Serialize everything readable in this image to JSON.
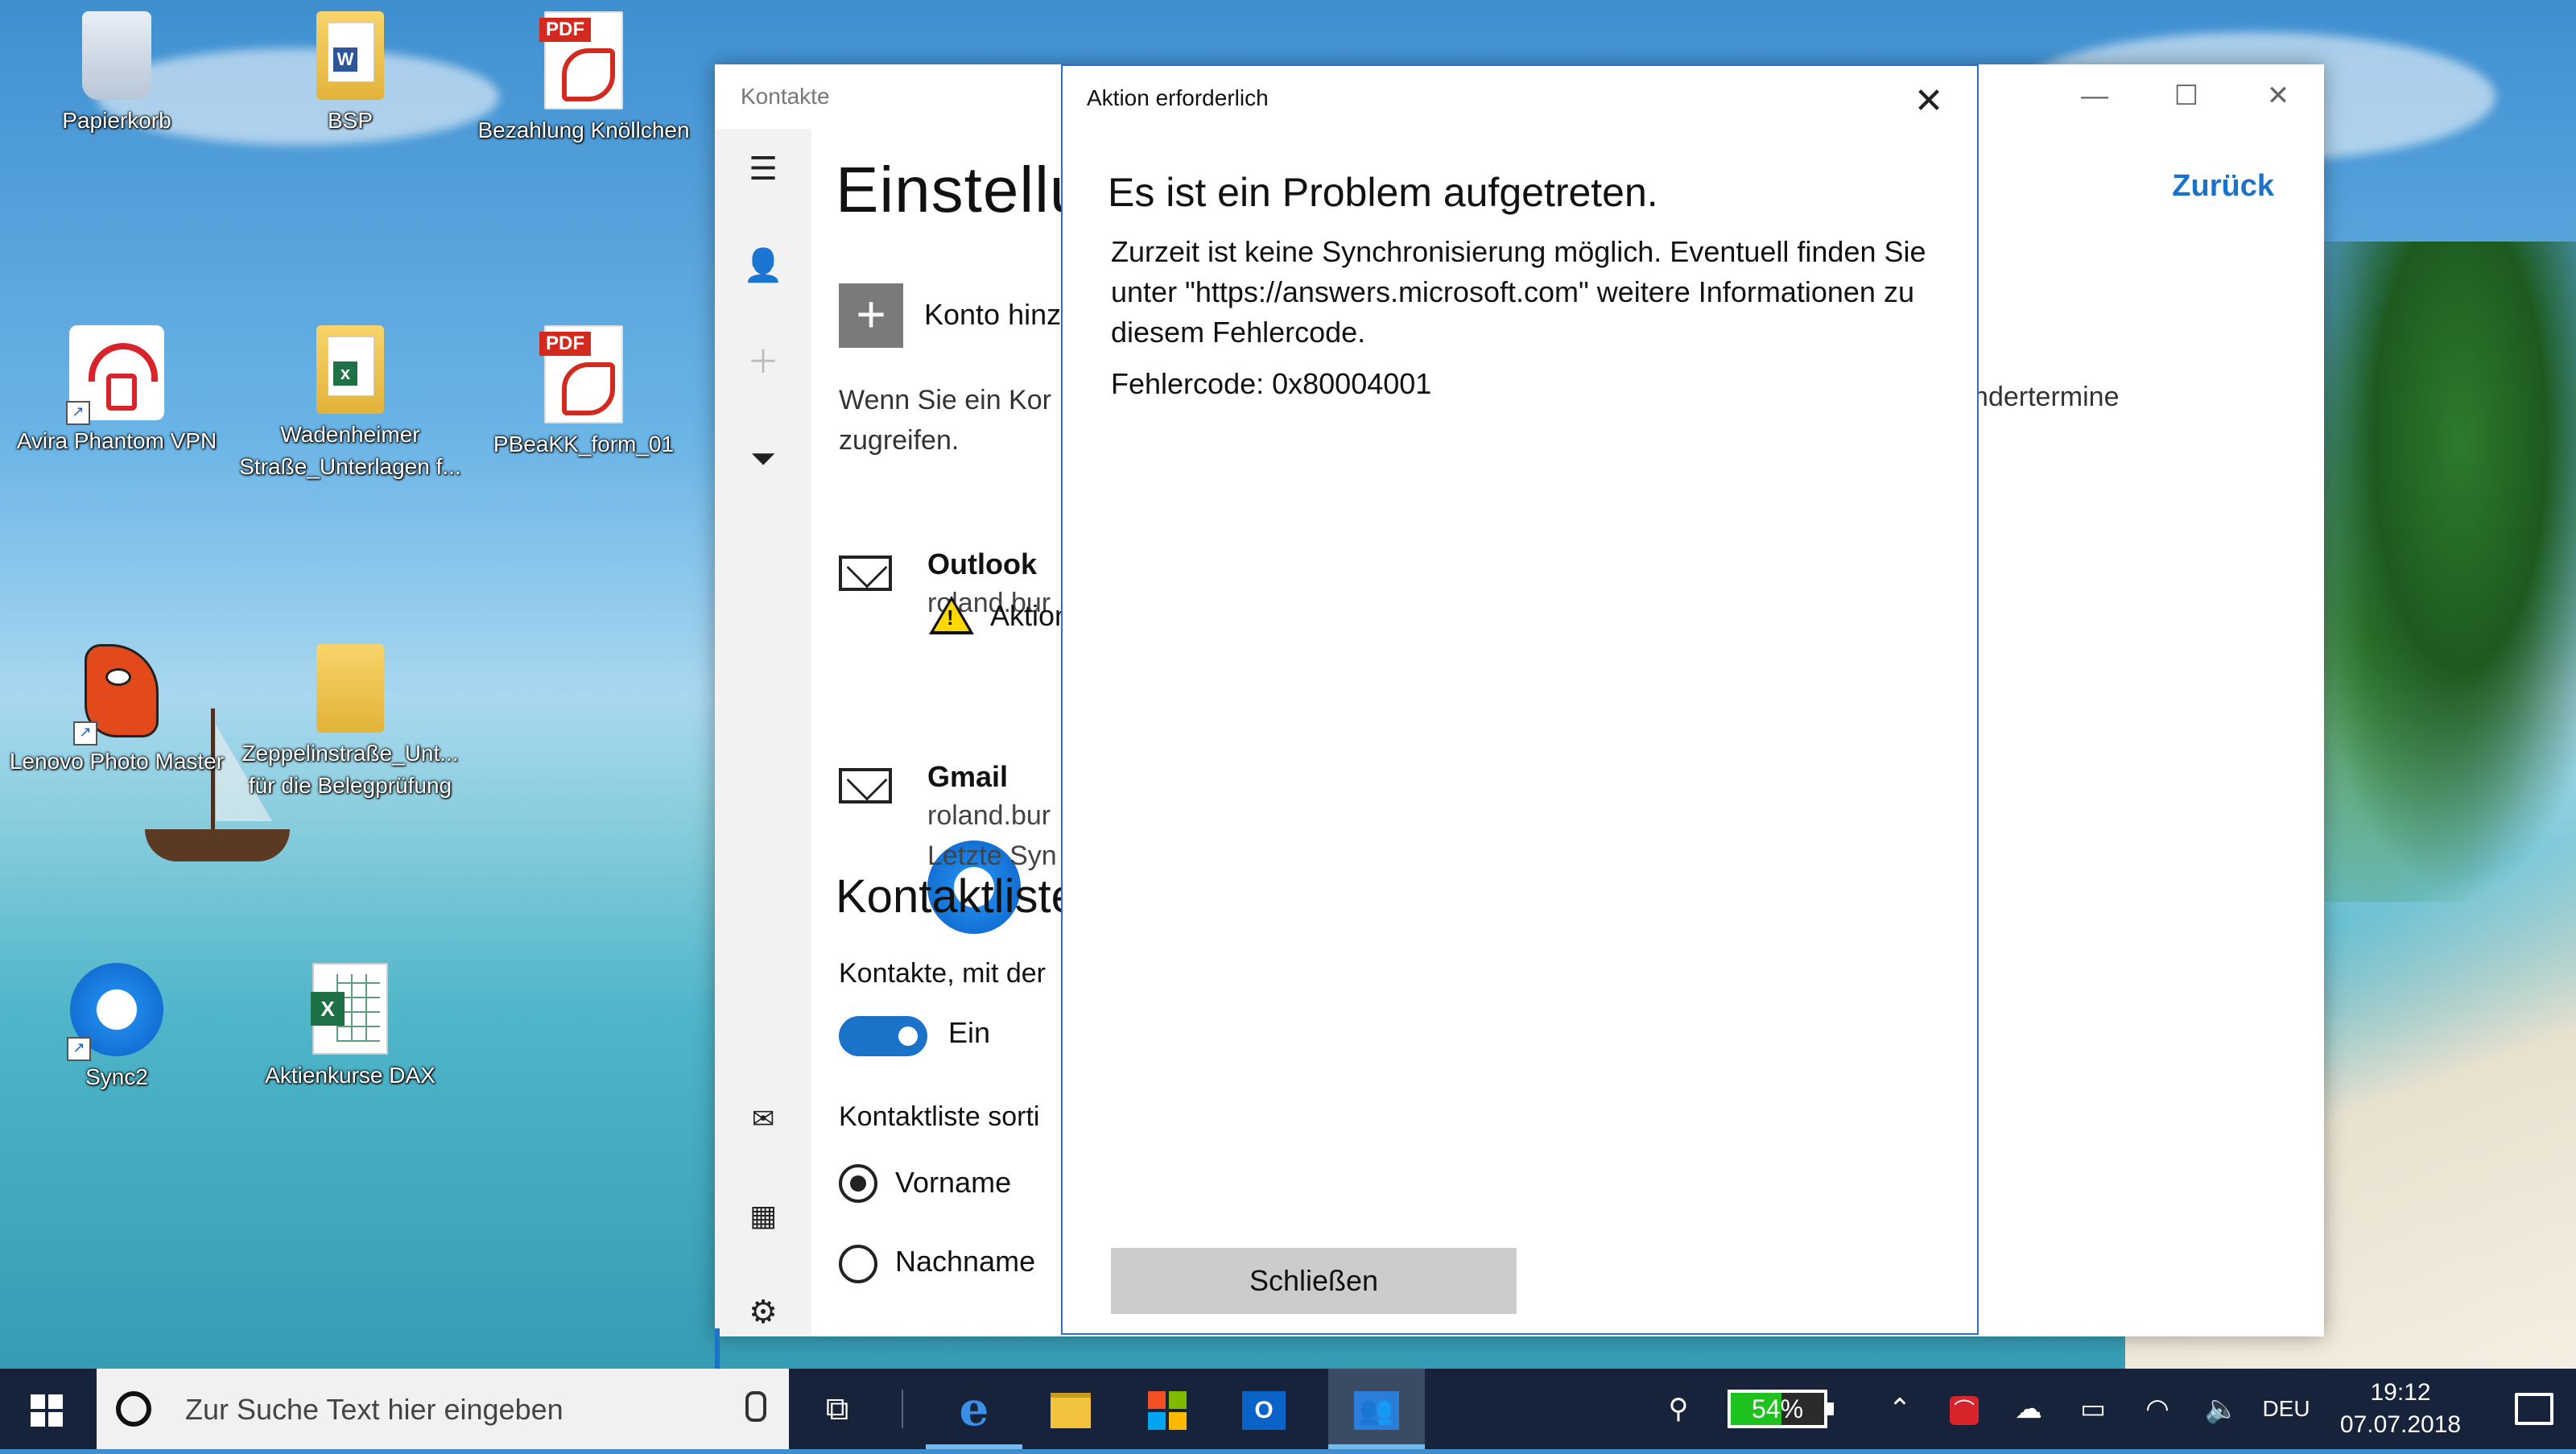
{
  "desktop": {
    "icons": [
      {
        "label": "Papierkorb"
      },
      {
        "label": "BSP"
      },
      {
        "label": "Bezahlung Knöllchen",
        "tag": "PDF"
      },
      {
        "label": "Avira Phantom VPN"
      },
      {
        "label": "Wadenheimer Straße_Unterlagen f...",
        "badge": "x"
      },
      {
        "label": "PBeaKK_form_01",
        "tag": "PDF"
      },
      {
        "label": "Lenovo Photo Master"
      },
      {
        "label": "Zeppelinstraße_Unt... für die Belegprüfung"
      },
      {
        "label": "Sync2"
      },
      {
        "label": "Aktienkurse DAX",
        "badge": "X"
      }
    ]
  },
  "app": {
    "title": "Kontakte",
    "heading": "Einstellu",
    "back": "Zurück",
    "add_account": "Konto hinz",
    "help_text": "Wenn Sie ein Kor zugreifen.",
    "help_text_right": "l Kalendertermine",
    "accounts": [
      {
        "name": "Outlook",
        "email": "roland.bur",
        "warning": "Aktion"
      },
      {
        "name": "Gmail",
        "email": "roland.bur",
        "sync": "Letzte Syn"
      }
    ],
    "contact_list_heading": "Kontaktliste",
    "contacts_with_label": "Kontakte, mit der",
    "toggle_label": "Ein",
    "toggle_on": true,
    "sort_label": "Kontaktliste sorti",
    "sort_options": [
      {
        "label": "Vorname",
        "selected": true
      },
      {
        "label": "Nachname",
        "selected": false
      }
    ],
    "window_buttons": {
      "minimize": "—",
      "maximize": "☐",
      "close": "✕"
    },
    "nav_icons": [
      "hamburger-icon",
      "person-icon",
      "add-icon",
      "filter-icon",
      "mail-icon",
      "calendar-icon",
      "gear-icon"
    ]
  },
  "dialog": {
    "title": "Aktion erforderlich",
    "close": "✕",
    "heading": "Es ist ein Problem aufgetreten.",
    "message": "Zurzeit ist keine Synchronisierung möglich. Eventuell finden Sie unter \"https://answers.microsoft.com\" weitere Informationen zu diesem Fehlercode.",
    "error_code": "Fehlercode: 0x80004001",
    "button": "Schließen",
    "accent": "#2b6fc6"
  },
  "taskbar": {
    "search_placeholder": "Zur Suche Text hier eingeben",
    "pinned": [
      "task-view-icon",
      "edge-icon",
      "file-explorer-icon",
      "store-icon",
      "outlook-icon",
      "people-icon"
    ],
    "outlook_badge": "O",
    "battery_percent": "54%",
    "battery_level": 0.54,
    "language": "DEU",
    "time": "19:12",
    "date": "07.07.2018",
    "accent": "#76b9ed"
  }
}
